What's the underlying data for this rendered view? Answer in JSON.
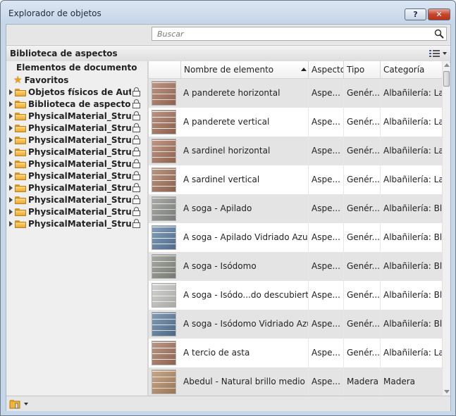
{
  "window": {
    "title": "Explorador de objetos",
    "help_label": "?",
    "close_label": "✕"
  },
  "search": {
    "placeholder": "Buscar"
  },
  "library": {
    "title": "Biblioteca de aspectos"
  },
  "tree": {
    "header": "Elementos de documento",
    "favorites": "Favoritos",
    "items": [
      {
        "label": "Objetos físicos de Autod...",
        "locked": true
      },
      {
        "label": "Biblioteca de aspectos",
        "locked": true
      },
      {
        "label": "PhysicalMaterial_Struct...",
        "locked": true
      },
      {
        "label": "PhysicalMaterial_Struct...",
        "locked": true
      },
      {
        "label": "PhysicalMaterial_Struct...",
        "locked": true
      },
      {
        "label": "PhysicalMaterial_Struct...",
        "locked": true
      },
      {
        "label": "PhysicalMaterial_Struct...",
        "locked": true
      },
      {
        "label": "PhysicalMaterial_Struct...",
        "locked": true
      },
      {
        "label": "PhysicalMaterial_Struct...",
        "locked": true
      },
      {
        "label": "PhysicalMaterial_Struct...",
        "locked": true
      },
      {
        "label": "PhysicalMaterial_Struct...",
        "locked": true
      },
      {
        "label": "PhysicalMaterial_Struct...",
        "locked": true
      }
    ]
  },
  "grid": {
    "columns": [
      "Nombre de elemento",
      "Aspecto",
      "Tipo",
      "Categoría"
    ],
    "rows": [
      {
        "name": "A panderete horizontal",
        "aspect": "Aspe...",
        "type": "Genér...",
        "category": "Albañilería: Ladr",
        "swatch": "#a8735c"
      },
      {
        "name": "A panderete vertical",
        "aspect": "Aspe...",
        "type": "Genér...",
        "category": "Albañilería: Ladr",
        "swatch": "#a57058"
      },
      {
        "name": "A sardinel horizontal",
        "aspect": "Aspe...",
        "type": "Genér...",
        "category": "Albañilería: Ladr",
        "swatch": "#a9745b"
      },
      {
        "name": "A sardinel vertical",
        "aspect": "Aspe...",
        "type": "Genér...",
        "category": "Albañilería: Ladr",
        "swatch": "#a6735a"
      },
      {
        "name": "A soga - Apilado",
        "aspect": "Aspe...",
        "type": "Genér...",
        "category": "Albañilería: Bloq",
        "swatch": "#8e918c"
      },
      {
        "name": "A soga - Apilado Vidriado Azul",
        "aspect": "Aspe...",
        "type": "Genér...",
        "category": "Albañilería: Bloq",
        "swatch": "#5b7ea8"
      },
      {
        "name": "A soga - Isódomo",
        "aspect": "Aspe...",
        "type": "Genér...",
        "category": "Albañilería: Bloq",
        "swatch": "#8b8e86"
      },
      {
        "name": "A soga - Isódo...do descubierto",
        "aspect": "Aspe...",
        "type": "Genér...",
        "category": "Albañilería: Bloq",
        "swatch": "#c5c5c2"
      },
      {
        "name": "A soga - Isódomo Vidriado Azul",
        "aspect": "Aspe...",
        "type": "Genér...",
        "category": "Albañilería: Bloq",
        "swatch": "#5a7b9f"
      },
      {
        "name": "A tercio de asta",
        "aspect": "Aspe...",
        "type": "Genér...",
        "category": "Albañilería: Ladr",
        "swatch": "#a7745d"
      },
      {
        "name": "Abedul - Natural brillo medio",
        "aspect": "Aspe...",
        "type": "Madera",
        "category": "Madera",
        "swatch": "#b58a62"
      }
    ]
  },
  "colors": {
    "title_gradient_top": "#dbe6f3",
    "close_red": "#c6452b",
    "row_alt": "#e4e4e4"
  }
}
